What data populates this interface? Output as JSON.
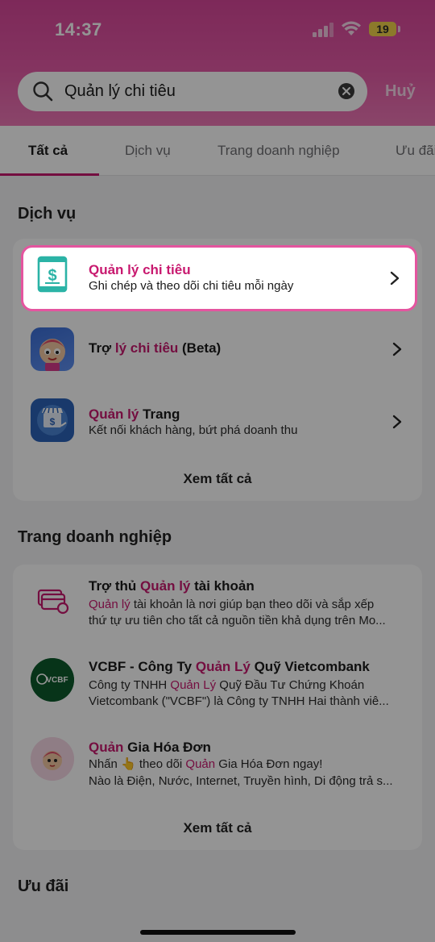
{
  "status": {
    "time": "14:37",
    "battery": "19"
  },
  "search": {
    "query": "Quản lý chi tiêu",
    "cancel_label": "Huỷ"
  },
  "tabs": [
    {
      "label": "Tất cả",
      "active": true
    },
    {
      "label": "Dịch vụ",
      "active": false
    },
    {
      "label": "Trang doanh nghiệp",
      "active": false
    },
    {
      "label": "Ưu đãi",
      "active": false
    }
  ],
  "services": {
    "title": "Dịch vụ",
    "highlighted": {
      "title": "Quản lý chi tiêu",
      "subtitle": "Ghi chép và theo dõi chi tiêu mỗi ngày"
    },
    "items": [
      {
        "title_pre": "Trợ ",
        "title_hl": "lý chi tiêu",
        "title_post": " (Beta)",
        "subtitle": ""
      },
      {
        "title_pre": "",
        "title_hl": "Quản lý",
        "title_post": " Trang",
        "subtitle": "Kết nối khách hàng, bứt phá doanh thu"
      }
    ],
    "see_all": "Xem tất cả"
  },
  "business": {
    "title": "Trang doanh nghiệp",
    "items": [
      {
        "title_pre": "Trợ thủ ",
        "title_hl": "Quản lý",
        "title_post": " tài khoản",
        "line1_hl": "Quản lý",
        "line1_post": " tài khoản là nơi giúp bạn theo dõi và sắp xếp",
        "line2": "thứ tự ưu tiên cho tất cả nguồn tiền khả dụng trên Mo..."
      },
      {
        "title_pre": "VCBF - Công Ty ",
        "title_hl": "Quản Lý",
        "title_post": " Quỹ Vietcombank",
        "line1_pre": "Công ty TNHH ",
        "line1_hl": "Quản Lý",
        "line1_post": " Quỹ Đầu Tư Chứng Khoán",
        "line2": "Vietcombank (\"VCBF\") là Công ty TNHH Hai thành viê...",
        "logo_text": "VCBF"
      },
      {
        "title_hl": "Quản",
        "title_post": " Gia Hóa Đơn",
        "line1_pre": "Nhấn 👆 theo dõi ",
        "line1_hl": "Quản",
        "line1_post": " Gia Hóa Đơn ngay!",
        "line2": "Nào là Điện, Nước, Internet, Truyền hình, Di động trả s..."
      }
    ],
    "see_all": "Xem tất cả"
  },
  "offers": {
    "title": "Ưu đãi"
  },
  "colors": {
    "brand": "#c8196f",
    "header": "#d8479a",
    "highlight_border": "#e4559f"
  },
  "icons": [
    "search-icon",
    "clear-icon",
    "chevron-right-icon",
    "money-book-icon",
    "card-stack-icon",
    "wifi-icon",
    "signal-icon"
  ]
}
